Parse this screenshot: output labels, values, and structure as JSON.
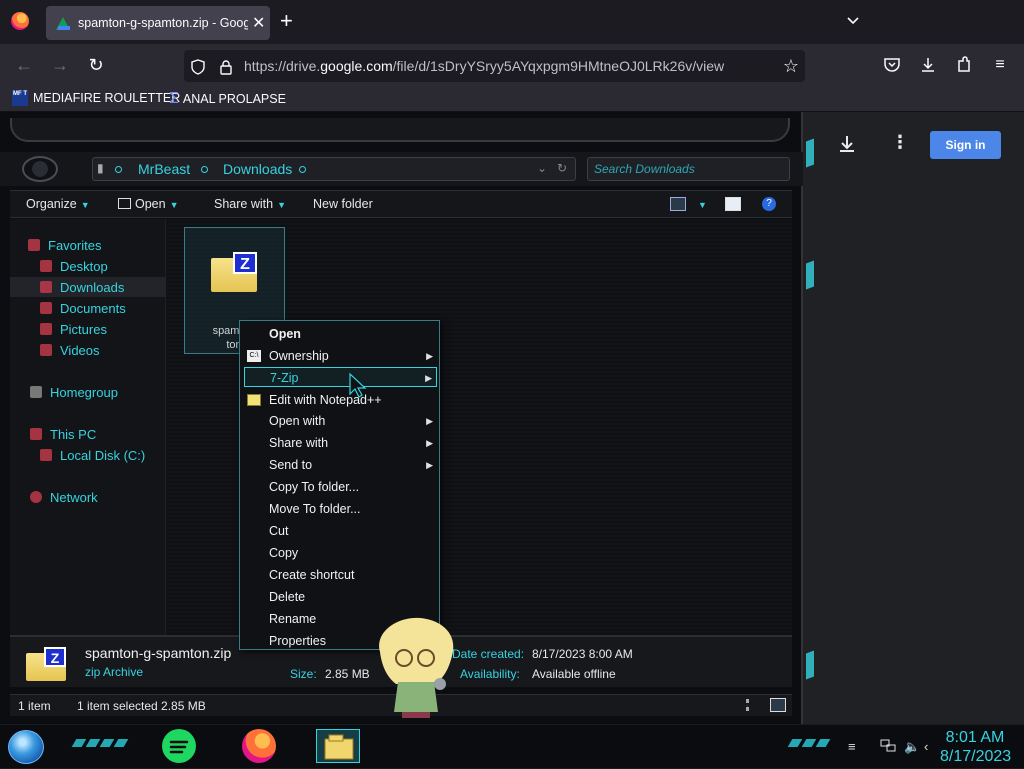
{
  "browser": {
    "tab": {
      "title": "spamton-g-spamton.zip - Goog",
      "close": "✕"
    },
    "new_tab": "+",
    "url_prefix": "https://drive.",
    "url_domain": "google.com",
    "url_path": "/file/d/1sDryYSryy5AYqxpgm9HMtneOJ0LRk26v/view",
    "bookmarks": [
      {
        "label": "MEDIAFIRE ROULETTER",
        "badge": "MF T"
      },
      {
        "label": "ANAL PROLAPSE"
      }
    ]
  },
  "drive": {
    "sign_in": "Sign in"
  },
  "explorer": {
    "breadcrumb": [
      "MrBeast",
      "Downloads"
    ],
    "search_placeholder": "Search Downloads",
    "toolbar": {
      "organize": "Organize",
      "open": "Open",
      "share_with": "Share with",
      "new_folder": "New folder"
    },
    "nav": {
      "favorites": "Favorites",
      "desktop": "Desktop",
      "downloads": "Downloads",
      "documents": "Documents",
      "pictures": "Pictures",
      "videos": "Videos",
      "homegroup": "Homegroup",
      "this_pc": "This PC",
      "local_disk": "Local Disk (C:)",
      "network": "Network"
    },
    "file": {
      "label_line1": "spamton-",
      "label_line2": "ton."
    },
    "details": {
      "name": "spamton-g-spamton.zip",
      "type": "zip Archive",
      "size_label": "Size:",
      "size_value": "2.85 MB",
      "date_label": "Date created:",
      "date_value": "8/17/2023 8:00 AM",
      "availability_label": "Availability:",
      "availability_value": "Available offline"
    },
    "status": {
      "items": "1 item",
      "selected": "1 item selected  2.85 MB"
    }
  },
  "context_menu": {
    "items": [
      {
        "label": "Open"
      },
      {
        "label": "Ownership"
      },
      {
        "label": "7-Zip"
      },
      {
        "label": "Edit with Notepad++"
      },
      {
        "label": "Open with"
      },
      {
        "label": "Share with"
      },
      {
        "label": "Send to"
      },
      {
        "label": "Copy To folder..."
      },
      {
        "label": "Move To folder..."
      },
      {
        "label": "Cut"
      },
      {
        "label": "Copy"
      },
      {
        "label": "Create shortcut"
      },
      {
        "label": "Delete"
      },
      {
        "label": "Rename"
      },
      {
        "label": "Properties"
      }
    ]
  },
  "taskbar": {
    "time": "8:01 AM",
    "date": "8/17/2023"
  },
  "colors": {
    "accent": "#36d3e0",
    "drive_signin": "#4b86e8",
    "tab_bg": "#42414d"
  }
}
